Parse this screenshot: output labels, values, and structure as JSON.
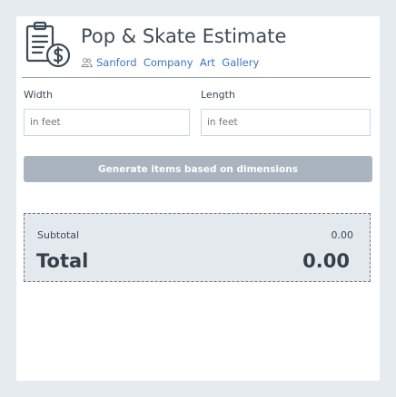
{
  "header": {
    "title": "Pop & Skate Estimate",
    "subtitle": "Sanford  Company  Art  Gallery",
    "logo_icon": "clipboard-dollar-icon",
    "subtitle_icon": "users-icon"
  },
  "form": {
    "width_label": "Width",
    "width_placeholder": "in feet",
    "length_label": "Length",
    "length_placeholder": "in feet",
    "generate_label": "Generate items based on dimensions"
  },
  "totals": {
    "subtotal_label": "Subtotal",
    "subtotal_value": "0.00",
    "total_label": "Total",
    "total_value": "0.00"
  },
  "colors": {
    "accent": "#3a78c2",
    "button": "#a9b4be",
    "totals_bg": "#e4e9ee"
  }
}
